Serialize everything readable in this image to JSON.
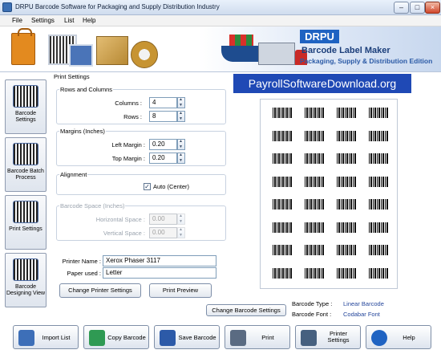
{
  "window": {
    "title": "DRPU Barcode Software for Packaging and Supply Distribution Industry",
    "controls": [
      "–",
      "□",
      "×"
    ]
  },
  "menu": [
    "File",
    "Settings",
    "List",
    "Help"
  ],
  "banner": {
    "brand": "DRPU",
    "product": "Barcode Label Maker",
    "edition": "Packaging, Supply & Distribution Edition"
  },
  "sidebar": [
    {
      "label": "Barcode Settings",
      "icon": "barcode-settings-icon"
    },
    {
      "label": "Barcode Batch Process",
      "icon": "batch-process-icon"
    },
    {
      "label": "Print Settings",
      "icon": "printer-icon"
    },
    {
      "label": "Barcode Designing View",
      "icon": "designing-view-icon"
    }
  ],
  "print_settings": {
    "title": "Print Settings",
    "rows_columns": {
      "title": "Rows and Columns",
      "columns_label": "Columns :",
      "columns_value": "4",
      "rows_label": "Rows :",
      "rows_value": "8"
    },
    "margins": {
      "title": "Margins (Inches)",
      "left_label": "Left Margin :",
      "left_value": "0.20",
      "top_label": "Top Margin :",
      "top_value": "0.20"
    },
    "alignment": {
      "title": "Alignment",
      "auto_label": "Auto (Center)",
      "auto_checked": true
    },
    "barcode_space": {
      "title": "Barcode Space (Inches)",
      "horizontal_label": "Horizontal Space :",
      "horizontal_value": "0.00",
      "vertical_label": "Vertical Space :",
      "vertical_value": "0.00"
    },
    "printer": {
      "name_label": "Printer Name :",
      "name_value": "Xerox Phaser 3117",
      "paper_label": "Paper used :",
      "paper_value": "Letter"
    },
    "change_printer_button": "Change Printer Settings",
    "print_preview_button": "Print Preview"
  },
  "preview": {
    "watermark": "PayrollSoftwareDownload.org",
    "grid_columns": 4,
    "grid_rows": 8,
    "change_barcode_button": "Change Barcode Settings",
    "barcode_type_label": "Barcode Type :",
    "barcode_type_value": "Linear Barcode",
    "barcode_font_label": "Barcode Font :",
    "barcode_font_value": "Codabar Font"
  },
  "toolbar": [
    {
      "label": "Import List",
      "icon": "import-list-icon",
      "color": "#3d6fb8"
    },
    {
      "label": "Copy Barcode",
      "icon": "copy-barcode-icon",
      "color": "#2f9a53"
    },
    {
      "label": "Save Barcode",
      "icon": "save-icon",
      "color": "#2c5aa8"
    },
    {
      "label": "Print",
      "icon": "print-icon",
      "color": "#5a6b82"
    },
    {
      "label": "Printer Settings",
      "icon": "printer-settings-icon",
      "color": "#46607f"
    },
    {
      "label": "Help",
      "icon": "help-icon",
      "color": "#1f63c2"
    }
  ]
}
